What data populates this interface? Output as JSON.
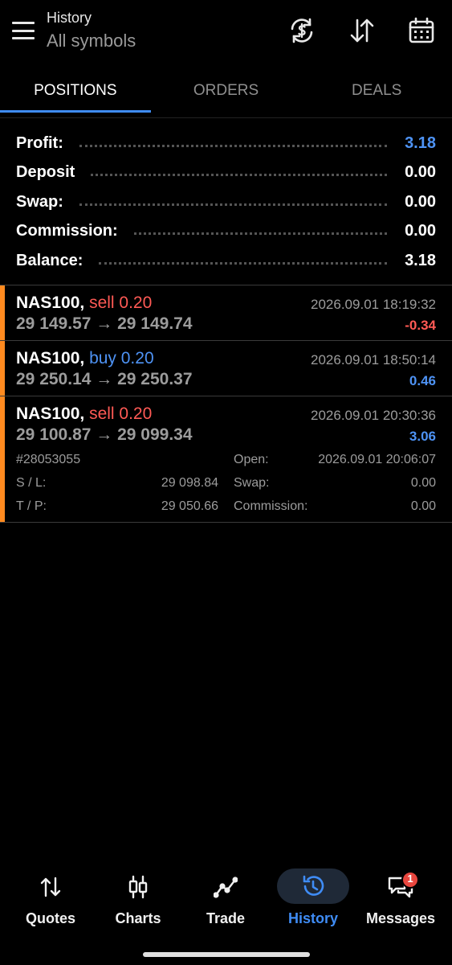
{
  "header": {
    "title": "History",
    "subtitle": "All symbols",
    "icons": [
      "menu-icon",
      "currency-sync-icon",
      "sort-icon",
      "calendar-icon"
    ]
  },
  "tabs": [
    {
      "label": "POSITIONS",
      "active": true
    },
    {
      "label": "ORDERS",
      "active": false
    },
    {
      "label": "DEALS",
      "active": false
    }
  ],
  "summary": [
    {
      "label": "Profit:",
      "value": "3.18",
      "color": "#4e93f5"
    },
    {
      "label": "Deposit",
      "value": "0.00"
    },
    {
      "label": "Swap:",
      "value": "0.00"
    },
    {
      "label": "Commission:",
      "value": "0.00"
    },
    {
      "label": "Balance:",
      "value": "3.18"
    }
  ],
  "positions": [
    {
      "symbol": "NAS100,",
      "side": "sell 0.20",
      "prices": "29 149.57 → 29 149.74",
      "time": "2026.09.01 18:19:32",
      "profit": "-0.34"
    },
    {
      "symbol": "NAS100,",
      "side": "buy 0.20",
      "prices": "29 250.14 → 29 250.37",
      "time": "2026.09.01 18:50:14",
      "profit": "0.46"
    },
    {
      "symbol": "NAS100,",
      "side": "sell 0.20",
      "prices": "29 100.87 → 29 099.34",
      "time": "2026.09.01 20:30:36",
      "profit": "3.06",
      "details": {
        "ticket": "#28053055",
        "open_label": "Open:",
        "open_value": "2026.09.01 20:06:07",
        "sl_label": "S / L:",
        "sl_value": "29 098.84",
        "swap_label": "Swap:",
        "swap_value": "0.00",
        "tp_label": "T / P:",
        "tp_value": "29 050.66",
        "commission_label": "Commission:",
        "commission_value": "0.00"
      }
    }
  ],
  "bottom_nav": [
    {
      "label": "Quotes",
      "icon": "quotes-icon",
      "active": false
    },
    {
      "label": "Charts",
      "icon": "candlestick-icon",
      "active": false
    },
    {
      "label": "Trade",
      "icon": "trade-icon",
      "active": false
    },
    {
      "label": "History",
      "icon": "history-icon",
      "active": true
    },
    {
      "label": "Messages",
      "icon": "messages-icon",
      "active": false,
      "badge": "1"
    }
  ],
  "colors": {
    "accent": "#3f8cf5",
    "profit_blue": "#4e93f5",
    "loss_red": "#ff5a55",
    "position_marker": "#ff8a1f"
  }
}
